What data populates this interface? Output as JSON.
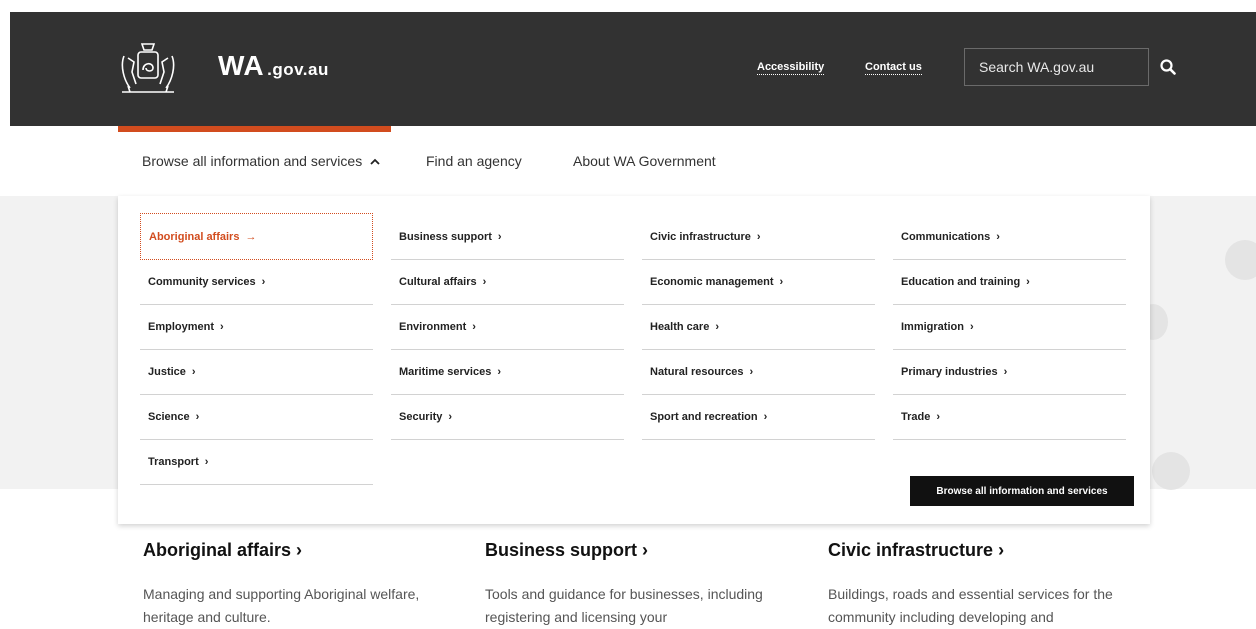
{
  "header": {
    "logo_main": "WA",
    "logo_sub": ".gov.au",
    "links": [
      "Accessibility",
      "Contact us"
    ],
    "search_placeholder": "Search WA.gov.au",
    "background": "#323232"
  },
  "nav": {
    "items": [
      "Browse all information and services",
      "Find an agency",
      "About WA Government"
    ],
    "accent_color": "#d24c1e"
  },
  "mega_menu": {
    "columns": [
      [
        "Aboriginal affairs",
        "Community services",
        "Employment",
        "Justice",
        "Science",
        "Transport"
      ],
      [
        "Business support",
        "Cultural affairs",
        "Environment",
        "Maritime services",
        "Security"
      ],
      [
        "Civic infrastructure",
        "Economic management",
        "Health care",
        "Natural resources",
        "Sport and recreation"
      ],
      [
        "Communications",
        "Education and training",
        "Immigration",
        "Primary industries",
        "Trade"
      ]
    ],
    "active_item": "Aboriginal affairs",
    "browse_all_label": "Browse all information and services"
  },
  "sections": [
    {
      "title": "Aboriginal affairs",
      "desc": "Managing and supporting Aboriginal welfare, heritage and culture."
    },
    {
      "title": "Business support",
      "desc": "Tools and guidance for businesses, including registering and licensing your"
    },
    {
      "title": "Civic infrastructure",
      "desc": "Buildings, roads and essential services for the community including developing and"
    }
  ]
}
